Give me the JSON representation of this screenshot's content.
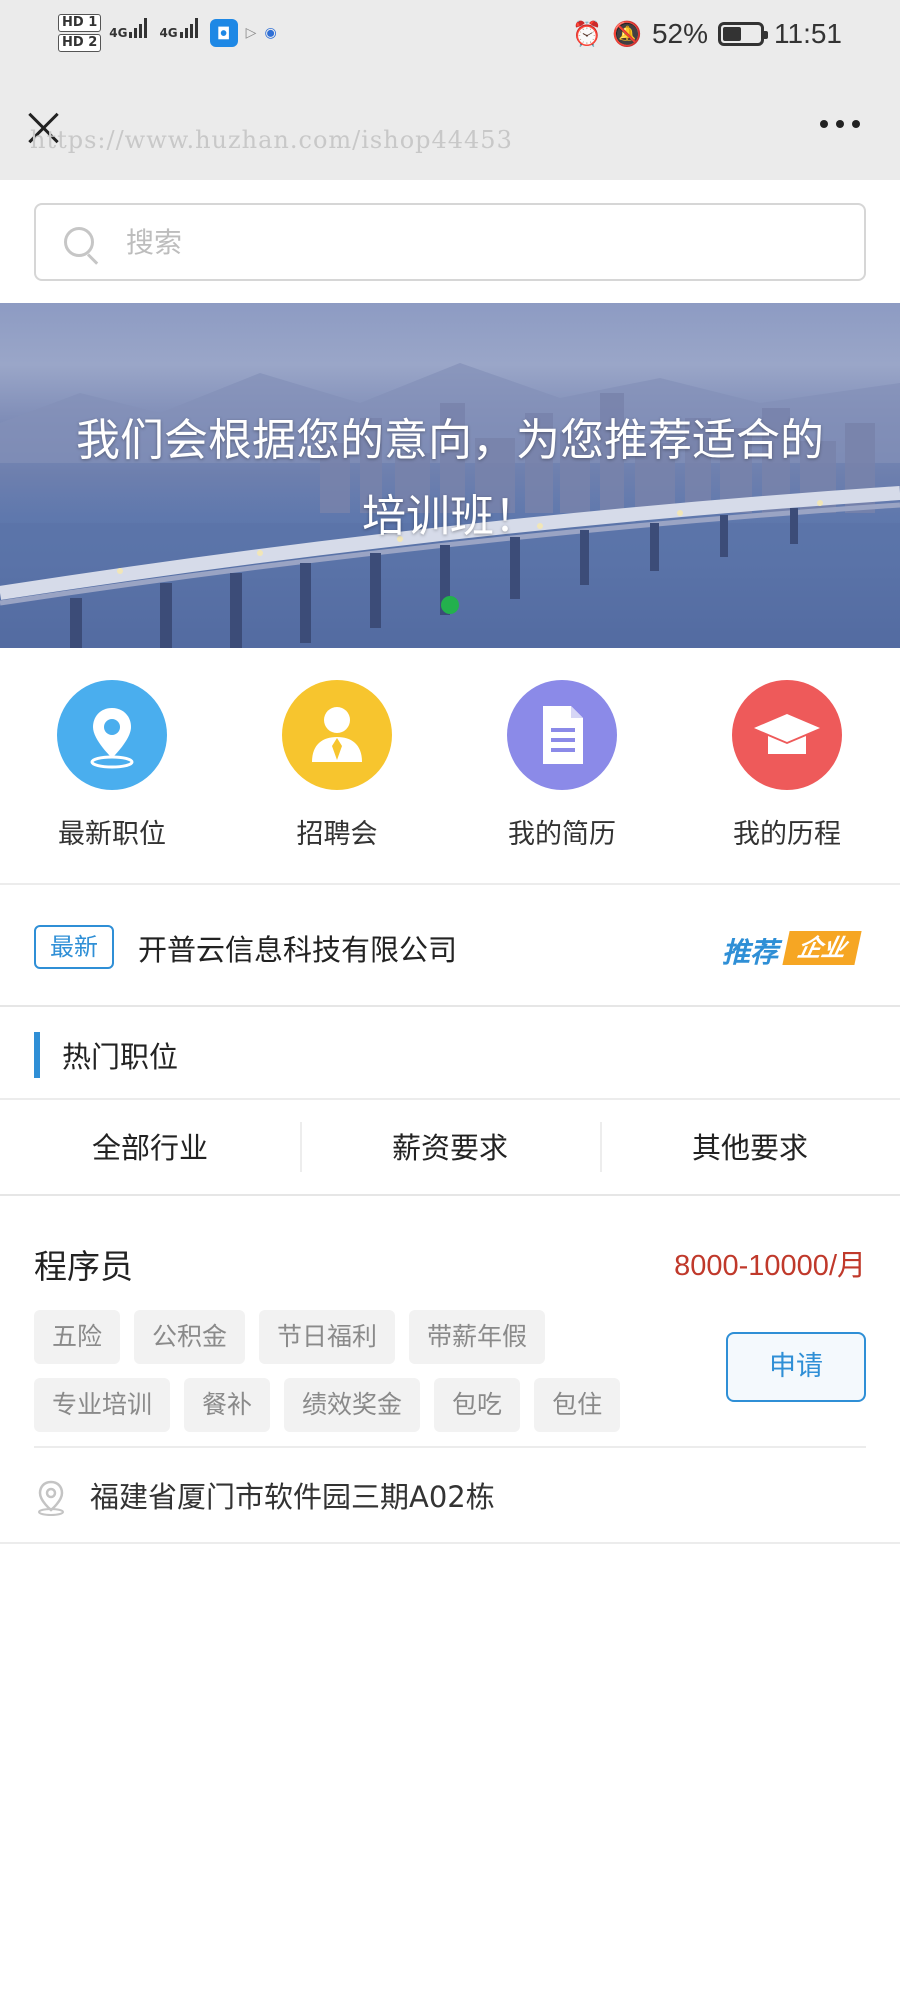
{
  "status_bar": {
    "hd1": "HD 1",
    "hd2": "HD 2",
    "net1": "4G",
    "net2": "4G",
    "battery_percent": "52%",
    "time": "11:51"
  },
  "watermark": "https://www.huzhan.com/ishop44453",
  "search": {
    "placeholder": "搜索"
  },
  "banner": {
    "line1": "我们会根据您的意向，为您推荐适合的",
    "line2": "培训班！"
  },
  "quick_entries": [
    {
      "label": "最新职位",
      "color": "#4aaeee",
      "icon": "location-pin-icon"
    },
    {
      "label": "招聘会",
      "color": "#f7c52e",
      "icon": "recruiter-icon"
    },
    {
      "label": "我的简历",
      "color": "#8b8ae8",
      "icon": "document-icon"
    },
    {
      "label": "我的历程",
      "color": "#ee5a5a",
      "icon": "graduation-cap-icon"
    }
  ],
  "recommend": {
    "tag": "最新",
    "company": "开普云信息科技有限公司",
    "logo_text_1": "推荐",
    "logo_text_2": "企业"
  },
  "hot_jobs": {
    "title": "热门职位",
    "filters": [
      "全部行业",
      "薪资要求",
      "其他要求"
    ]
  },
  "job": {
    "title": "程序员",
    "salary": "8000-10000/月",
    "benefits": [
      "五险",
      "公积金",
      "节日福利",
      "带薪年假",
      "专业培训",
      "餐补",
      "绩效奖金",
      "包吃",
      "包住"
    ],
    "apply_label": "申请",
    "address": "福建省厦门市软件园三期A02栋"
  },
  "colors": {
    "accent": "#2f8fd6",
    "salary": "#c0392b",
    "banner_dot": "#23b14d"
  }
}
